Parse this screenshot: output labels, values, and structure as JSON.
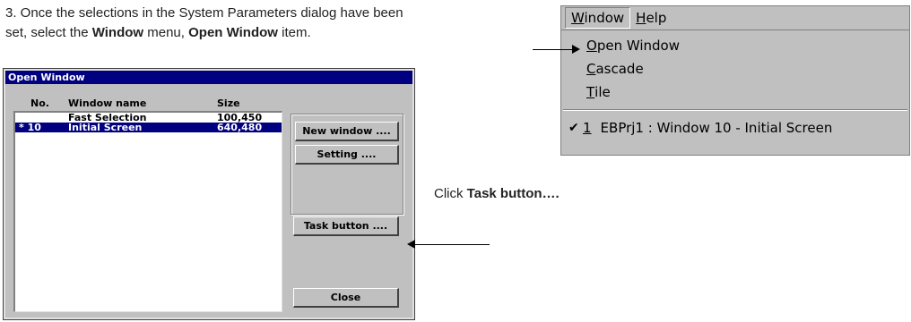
{
  "instruction": {
    "line1": "3. Once the selections in the System Parameters dialog have been",
    "line2_pre": "set, select the ",
    "line2_window": "Window",
    "line2_mid": " menu, ",
    "line2_item": "Open Window",
    "line2_post": " item."
  },
  "click_note": {
    "pre": "Click ",
    "target": "Task button…."
  },
  "menu": {
    "bar": [
      {
        "label": "Window",
        "accel": "W",
        "rest": "indow"
      },
      {
        "label": "Help",
        "accel": "H",
        "rest": "elp"
      }
    ],
    "items": [
      {
        "accel": "O",
        "rest": "pen Window"
      },
      {
        "accel": "C",
        "rest": "ascade"
      },
      {
        "accel": "T",
        "rest": "ile"
      }
    ],
    "window_entry": {
      "check": "✔",
      "number": "1",
      "text": "EBPrj1  :  Window 10  -  Initial Screen"
    }
  },
  "dialog": {
    "title": "Open Window",
    "columns": {
      "no": "No.",
      "name": "Window name",
      "size": "Size"
    },
    "rows": [
      {
        "no": "",
        "name": "Fast Selection",
        "size": "100,450",
        "selected": false
      },
      {
        "no": "* 10",
        "name": "Initial Screen",
        "size": "640,480",
        "selected": true
      }
    ],
    "buttons": {
      "new_window": "New window ....",
      "setting": "Setting ....",
      "task_button": "Task button ....",
      "close": "Close"
    }
  },
  "colors": {
    "selection": "#000080",
    "face": "#c0c0c0",
    "titlebar": "#000080"
  }
}
